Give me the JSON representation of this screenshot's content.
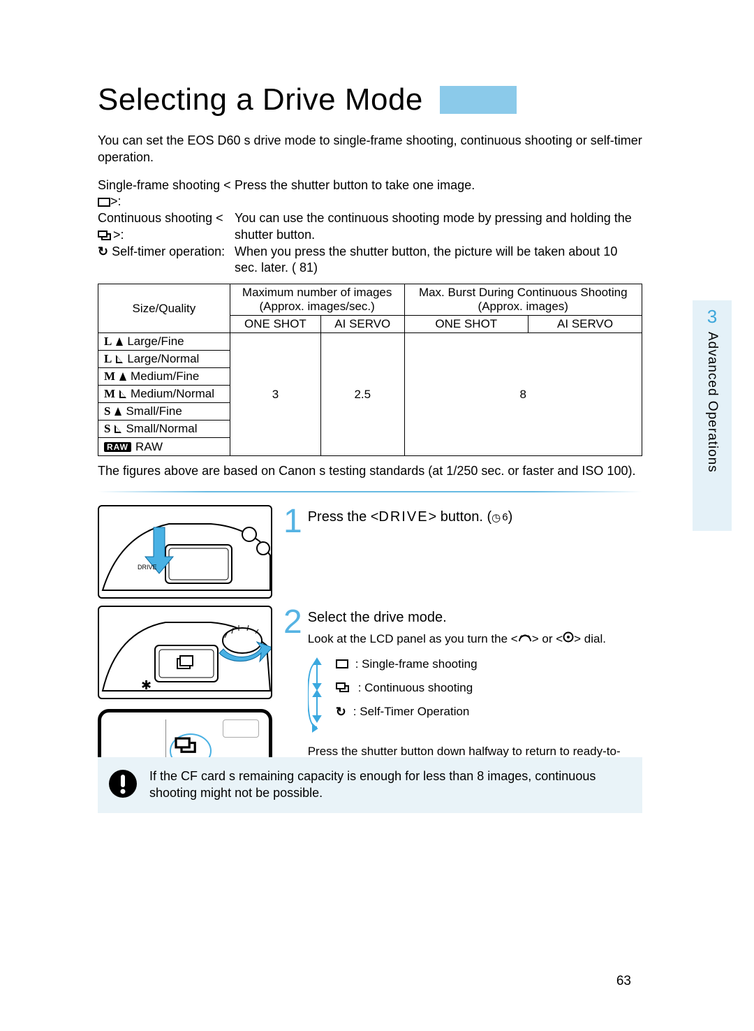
{
  "title": "Selecting a Drive Mode",
  "intro": "You can set the EOS D60 s drive mode to single-frame shooting, continuous shooting or self-timer operation.",
  "modes": {
    "single": {
      "label": "Single-frame shooting <",
      "label_after": ">:",
      "desc": "Press the shutter button to take one image."
    },
    "continuous": {
      "label": "Continuous shooting <",
      "label_after": ">:",
      "desc": "You can use the continuous shooting mode by pressing and holding the shutter button."
    },
    "selftimer": {
      "label": "Self-timer operation:",
      "desc": "When you press the shutter button, the picture will be taken about 10 sec. later. (   81)"
    }
  },
  "table": {
    "h_size": "Size/Quality",
    "h_max1": "Maximum number of images",
    "h_max2": "(Approx. images/sec.)",
    "h_burst1": "Max. Burst During Continuous Shooting",
    "h_burst2": "(Approx. images)",
    "oneshot": "ONE SHOT",
    "aiservo": "AI SERVO",
    "rows": [
      {
        "sz": "L",
        "qual": "fine",
        "label": "Large/Fine"
      },
      {
        "sz": "L",
        "qual": "normal",
        "label": "Large/Normal"
      },
      {
        "sz": "M",
        "qual": "fine",
        "label": "Medium/Fine"
      },
      {
        "sz": "M",
        "qual": "normal",
        "label": "Medium/Normal"
      },
      {
        "sz": "S",
        "qual": "fine",
        "label": "Small/Fine"
      },
      {
        "sz": "S",
        "qual": "normal",
        "label": "Small/Normal"
      }
    ],
    "raw": "RAW",
    "v_oneshot": "3",
    "v_aiservo": "2.5",
    "v_burst": "8"
  },
  "table_note": "The figures above are based on Canon s testing standards (at 1/250 sec. or faster and ISO 100).",
  "steps": {
    "s1": {
      "num": "1",
      "title_a": "Press the <",
      "title_mid": "DRIVE",
      "title_b": "> button. (",
      "title_c": ")",
      "timer6": "6"
    },
    "s2": {
      "num": "2",
      "title": "Select the drive mode.",
      "sub_a": "Look at the LCD panel as you turn the <",
      "sub_b": "> or <",
      "sub_c": "> dial.",
      "items": {
        "single": ": Single-frame shooting",
        "continuous": ": Continuous shooting",
        "selftimer": ": Self-Timer Operation"
      },
      "after": "Press the shutter button down halfway to return to ready-to-shoot mode."
    }
  },
  "warning": "If the CF card s remaining capacity is enough for less than 8 images, continuous shooting might not be possible.",
  "page_number": "63",
  "side": {
    "chapter": "3",
    "label": "Advanced Operations"
  }
}
